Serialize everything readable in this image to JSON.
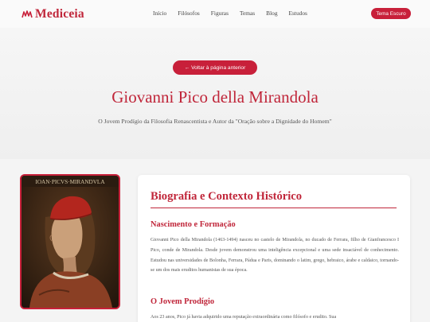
{
  "header": {
    "logo_text": "Mediceia",
    "nav": [
      "Início",
      "Filósofos",
      "Figuras",
      "Temas",
      "Blog",
      "Estudos"
    ],
    "theme_button": "Tema Escuro"
  },
  "hero": {
    "back_button": "← Voltar à página anterior",
    "title": "Giovanni Pico della Mirandola",
    "subtitle": "O Jovem Prodígio da Filosofia Renascentista e Autor da \"Oração sobre a Dignidade do Homem\""
  },
  "portrait": {
    "inscription": "IOAN·PICVS·MIRANDVLA"
  },
  "card": {
    "title": "Biografia e Contexto Histórico",
    "sections": [
      {
        "title": "Nascimento e Formação",
        "body": "Giovanni Pico della Mirandola (1463-1494) nasceu no castelo de Mirandola, no ducado de Ferrara, filho de Gianfrancesco I Pico, conde de Mirandola. Desde jovem demonstrou uma inteligência excepcional e uma sede insaciável de conhecimento. Estudou nas universidades de Bolonha, Ferrara, Pádua e Paris, dominando o latim, grego, hebraico, árabe e caldaico, tornando-se um dos mais eruditos humanistas de sua época."
      },
      {
        "title": "O Jovem Prodígio",
        "body": "Aos 23 anos, Pico já havia adquirido uma reputação extraordinária como filósofo e erudito. Sua"
      }
    ]
  },
  "colors": {
    "accent": "#c8203a",
    "title": "#c0263a",
    "background": "#f4f4f4"
  }
}
